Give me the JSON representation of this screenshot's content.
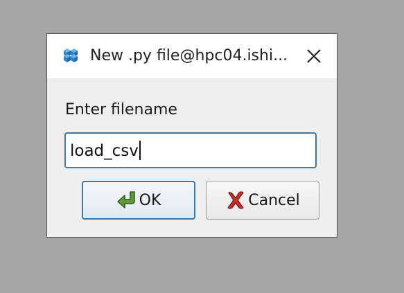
{
  "dialog": {
    "title": "New .py file@hpc04.ishi...",
    "app_icon": "cube-cluster-icon",
    "close_icon": "close-icon",
    "prompt_label": "Enter filename",
    "filename_value": "load_csv",
    "ok_label": "OK",
    "ok_icon": "return-arrow-icon",
    "cancel_label": "Cancel",
    "cancel_icon": "red-x-icon"
  },
  "colors": {
    "focus_border": "#3e78a9",
    "background": "#a6a6a6",
    "dialog_body": "#efefef"
  }
}
